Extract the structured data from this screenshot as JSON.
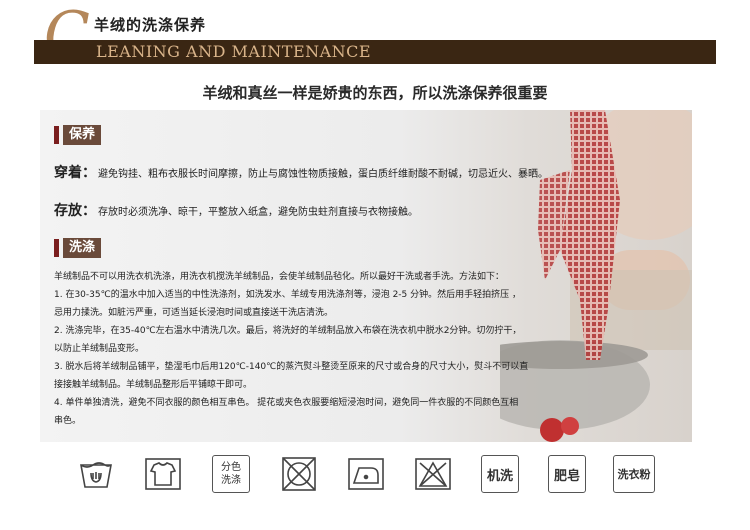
{
  "header": {
    "logo_letter": "C",
    "title_cn": "羊绒的洗涤保养",
    "title_en": "LEANING AND MAINTENANCE",
    "subtitle": "羊绒和真丝一样是娇贵的东西，所以洗涤保养很重要"
  },
  "maintenance": {
    "tag": "保养",
    "wear_label": "穿着：",
    "wear_text": "避免钩挂、粗布衣服长时间摩擦，防止与腐蚀性物质接触，蛋白质纤维耐酸不耐碱，切忌近火、暴晒。",
    "store_label": "存放：",
    "store_text": "存放时必须洗净、晾干，平整放入纸盒，避免防虫蛀剂直接与衣物接触。"
  },
  "washing": {
    "tag": "洗涤",
    "lines": [
      "羊绒制品不可以用洗衣机洗涤，用洗衣机搅洗羊绒制品，会使羊绒制品毡化。所以最好干洗或者手洗。方法如下：",
      "1.  在30-35℃的温水中加入适当的中性洗涤剂，如洗发水、羊绒专用洗涤剂等，浸泡 2-5 分钟。然后用手轻拍挤压 ，",
      "忌用力揉洗。如脏污严重，可适当延长浸泡时间或直接送干洗店清洗。",
      "2.  洗涤完毕，在35-40℃左右温水中清洗几次。最后，将洗好的羊绒制品放入布袋在洗衣机中脱水2分钟。切勿拧干，",
      "以防止羊绒制品变形。",
      "3.  脱水后将羊绒制品铺平，垫湿毛巾后用120℃-140℃的蒸汽熨斗整烫至原来的尺寸或合身的尺寸大小，熨斗不可以直",
      "接接触羊绒制品。羊绒制品整形后平铺晾干即可。",
      "4.  单件单独清洗，避免不同衣服的颜色相互串色。 提花或夹色衣服要缩短浸泡时间，避免同一件衣服的不同颜色互相",
      "串色。"
    ]
  },
  "care_icons": [
    {
      "icon": "hand-wash-icon"
    },
    {
      "icon": "shirt-icon"
    },
    {
      "icon": "separate-colors-icon",
      "line1": "分色",
      "line2": "洗涤"
    },
    {
      "icon": "no-tumble-dry-icon"
    },
    {
      "icon": "iron-icon"
    },
    {
      "icon": "no-bleach-icon"
    },
    {
      "icon": "no-machine-wash-icon",
      "label": "机洗"
    },
    {
      "icon": "no-soap-icon",
      "label": "肥皂"
    },
    {
      "icon": "no-detergent-icon",
      "label": "洗衣粉"
    }
  ],
  "colors": {
    "banner": "#3a2613",
    "banner_text": "#d9b48a",
    "tag_bg": "#6a4a3a",
    "tag_bar": "#7a1e1e",
    "logo": "#b4875a"
  }
}
